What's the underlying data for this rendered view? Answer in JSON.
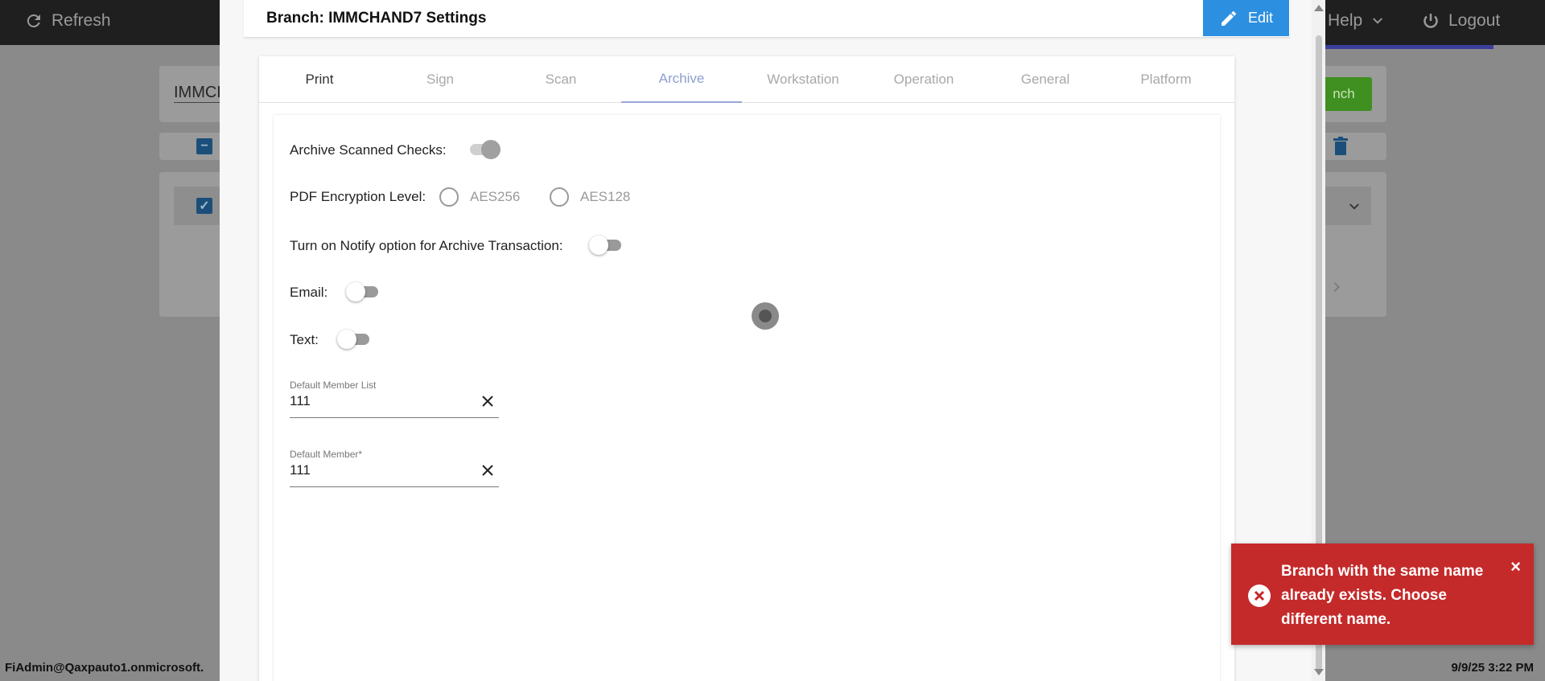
{
  "background": {
    "refresh_label": "Refresh",
    "help_label": "Help",
    "logout_label": "Logout",
    "search_value_partial": "IMMCH",
    "green_button_partial": "nch",
    "footer_user": "FiAdmin@Qaxpauto1.onmicrosoft.",
    "footer_datetime": "9/9/25 3:22 PM"
  },
  "modal": {
    "title": "Branch: IMMCHAND7 Settings",
    "edit_label": "Edit",
    "tabs": [
      {
        "label": "Print"
      },
      {
        "label": "Sign"
      },
      {
        "label": "Scan"
      },
      {
        "label": "Archive"
      },
      {
        "label": "Workstation"
      },
      {
        "label": "Operation"
      },
      {
        "label": "General"
      },
      {
        "label": "Platform"
      }
    ],
    "active_tab": "Archive",
    "archive": {
      "archive_scanned_checks_label": "Archive Scanned Checks:",
      "pdf_encryption_label": "PDF Encryption Level:",
      "pdf_options": [
        "AES256",
        "AES128"
      ],
      "notify_label": "Turn on Notify option for Archive Transaction:",
      "email_label": "Email:",
      "text_label": "Text:",
      "default_member_list": {
        "label": "Default Member List",
        "value": "111"
      },
      "default_member": {
        "label": "Default Member*",
        "value": "111"
      }
    }
  },
  "toast": {
    "message": "Branch with the same name already exists. Choose different name.",
    "close_glyph": "×"
  },
  "colors": {
    "accent_blue": "#2c8fe0",
    "error_red": "#c52a2a",
    "active_tab": "#8e9fcf"
  }
}
